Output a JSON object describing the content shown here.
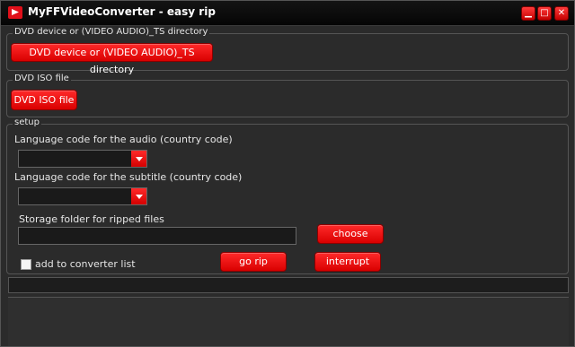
{
  "window": {
    "title": "MyFFVideoConverter - easy rip"
  },
  "titlebar_buttons": {
    "minimize": "▁",
    "maximize": "□",
    "close": "✕"
  },
  "dvd_device": {
    "group_label": "DVD device or (VIDEO AUDIO)_TS directory",
    "button_label": "DVD device or (VIDEO AUDIO)_TS directory"
  },
  "dvd_iso": {
    "group_label": "DVD ISO file",
    "button_label": "DVD ISO file"
  },
  "setup": {
    "group_label": "setup",
    "audio_label": "Language code for the audio (country code)",
    "audio_value": "",
    "subtitle_label": "Language code for the subtitle (country code)",
    "subtitle_value": "",
    "storage_label": "Storage folder for ripped files",
    "storage_value": "",
    "choose_label": "choose",
    "add_to_list_label": "add to converter list",
    "add_to_list_checked": false,
    "go_rip_label": "go rip",
    "interrupt_label": "interrupt"
  },
  "status": {
    "text": ""
  },
  "log": {
    "text": ""
  },
  "colors": {
    "accent": "#e60000",
    "background": "#2b2b2b",
    "text": "#e6e6e6"
  },
  "icons": {
    "app": "video-converter-icon"
  }
}
